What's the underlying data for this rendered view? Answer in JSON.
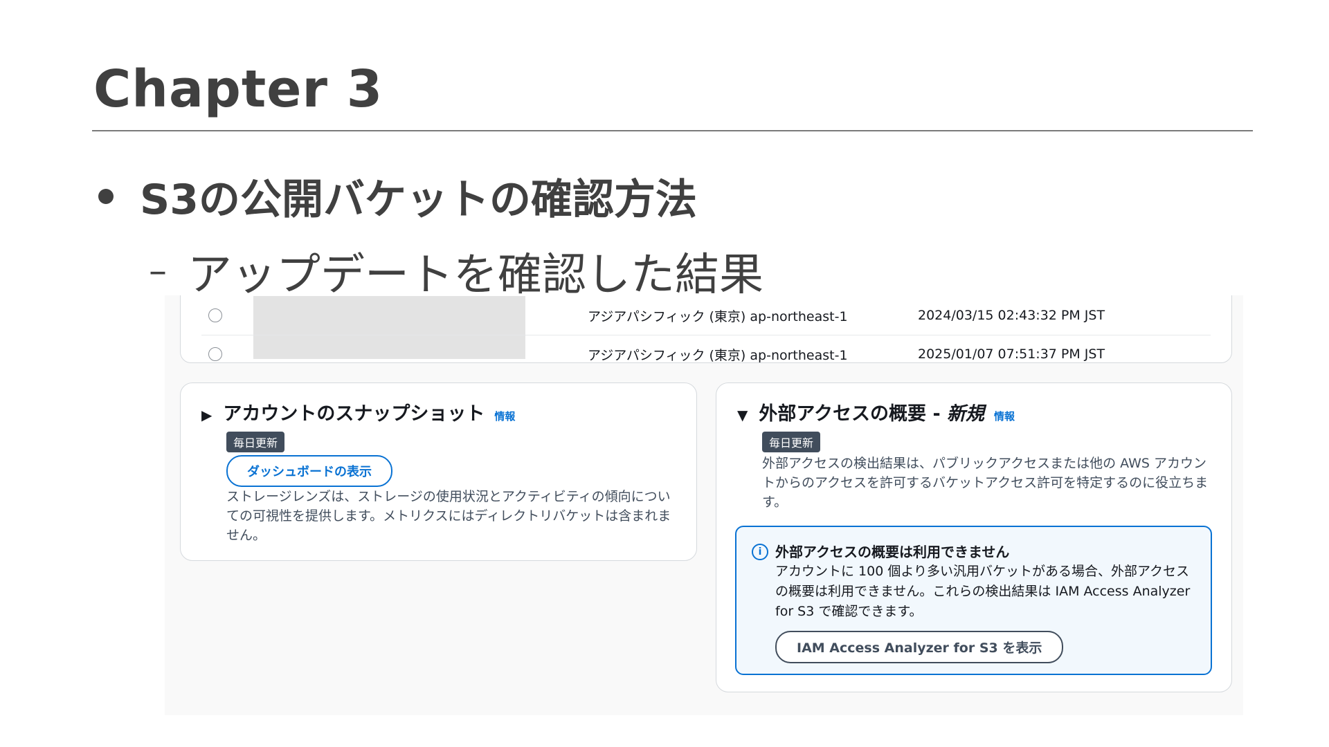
{
  "slide": {
    "title": "Chapter 3",
    "bullet": "S3の公開バケットの確認方法",
    "sub_dash": "–",
    "sub_bullet": "アップデートを確認した結果"
  },
  "table": {
    "rows": [
      {
        "region": "アジアパシフィック (東京) ap-northeast-1",
        "date": "2024/03/15 02:43:32 PM JST"
      },
      {
        "region": "アジアパシフィック (東京) ap-northeast-1",
        "date": "2025/01/07 07:51:37 PM JST"
      }
    ]
  },
  "snapshot": {
    "caret": "▶",
    "title": "アカウントのスナップショット",
    "info": "情報",
    "badge": "毎日更新",
    "button": "ダッシュボードの表示",
    "description": "ストレージレンズは、ストレージの使用状況とアクティビティの傾向についての可視性を提供します。メトリクスにはディレクトリバケットは含まれません。"
  },
  "external_access": {
    "caret": "▼",
    "title": "外部アクセスの概要 - ",
    "title_new": "新規",
    "info": "情報",
    "badge": "毎日更新",
    "description": "外部アクセスの検出結果は、パブリックアクセスまたは他の AWS アカウントからのアクセスを許可するバケットアクセス許可を特定するのに役立ちます。",
    "alert": {
      "icon": "i",
      "title": "外部アクセスの概要は利用できません",
      "body": "アカウントに 100 個より多い汎用バケットがある場合、外部アクセスの概要は利用できません。これらの検出結果は IAM Access Analyzer for S3 で確認できます。",
      "button": "IAM Access Analyzer for S3 を表示"
    }
  },
  "colors": {
    "link": "#0972d3",
    "badge": "#414d5c",
    "alert_bg": "#f2f8fd",
    "slide_text": "#404040"
  }
}
